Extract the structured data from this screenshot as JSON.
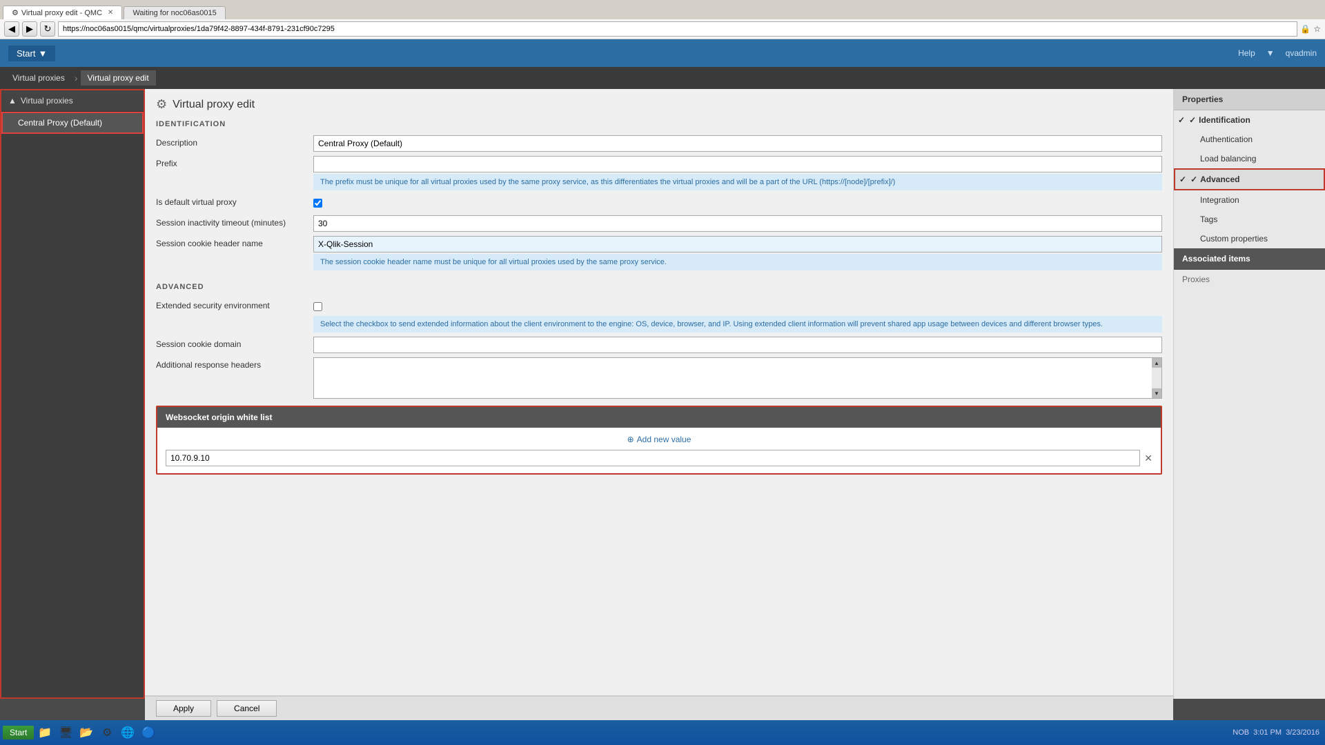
{
  "browser": {
    "address": "https://noc06as0015/qmc/virtualproxies/1da79f42-8897-434f-8791-231cf90c7295",
    "tabs": [
      {
        "label": "Virtual proxy edit - QMC",
        "active": true,
        "closeable": true
      },
      {
        "label": "Waiting for noc06as0015",
        "active": false,
        "closeable": false
      }
    ],
    "nav_back": "◀",
    "nav_forward": "▶",
    "refresh": "↻",
    "lock_icon": "🔒"
  },
  "app_header": {
    "start_label": "Start",
    "help_label": "Help",
    "user_label": "qvadmin"
  },
  "breadcrumb": {
    "items": [
      "Virtual proxies",
      "Virtual proxy edit"
    ]
  },
  "sidebar": {
    "section_label": "Virtual proxies",
    "items": [
      {
        "label": "Central Proxy (Default)",
        "active": true
      }
    ]
  },
  "page_title": "Virtual proxy edit",
  "form": {
    "identification_header": "IDENTIFICATION",
    "fields": {
      "description_label": "Description",
      "description_value": "Central Proxy (Default)",
      "prefix_label": "Prefix",
      "prefix_value": "",
      "prefix_hint": "The prefix must be unique for all virtual proxies used by the same proxy service, as this differentiates the virtual proxies and will be a part of the URL (https://[node]/[prefix]/)",
      "is_default_label": "Is default virtual proxy",
      "is_default_checked": true,
      "session_timeout_label": "Session inactivity timeout (minutes)",
      "session_timeout_value": "30",
      "session_cookie_label": "Session cookie header name",
      "session_cookie_value": "X-Qlik-Session",
      "session_cookie_hint": "The session cookie header name must be unique for all virtual proxies used by the same proxy service."
    },
    "advanced_header": "ADVANCED",
    "advanced_fields": {
      "extended_security_label": "Extended security environment",
      "extended_security_checked": false,
      "extended_security_hint": "Select the checkbox to send extended information about the client environment to the engine: OS, device, browser, and IP. Using extended client information will prevent shared app usage between devices and different browser types.",
      "session_cookie_domain_label": "Session cookie domain",
      "session_cookie_domain_value": "",
      "additional_headers_label": "Additional response headers",
      "additional_headers_value": ""
    }
  },
  "websocket": {
    "section_label": "Websocket origin white list",
    "add_btn": "Add new value",
    "entries": [
      {
        "value": "10.70.9.10"
      }
    ]
  },
  "footer": {
    "apply_label": "Apply",
    "cancel_label": "Cancel"
  },
  "properties_panel": {
    "title": "Properties",
    "items": [
      {
        "label": "Identification",
        "active": true,
        "checked": true
      },
      {
        "label": "Authentication",
        "active": false,
        "checked": false
      },
      {
        "label": "Load balancing",
        "active": false,
        "checked": false
      },
      {
        "label": "Advanced",
        "active": true,
        "checked": true,
        "highlighted": true
      },
      {
        "label": "Integration",
        "active": false,
        "checked": false
      },
      {
        "label": "Tags",
        "active": false,
        "checked": false
      },
      {
        "label": "Custom properties",
        "active": false,
        "checked": false
      }
    ],
    "associated_title": "Associated items",
    "associated_items": [
      {
        "label": "Proxies"
      }
    ]
  },
  "taskbar": {
    "time": "3:01 PM",
    "date": "3/23/2016",
    "start_label": "Start",
    "language": "NOB"
  },
  "icons": {
    "gear": "⚙",
    "checkmark": "✓",
    "plus_circle": "⊕",
    "close": "✕",
    "arrow_down": "▼",
    "arrow_up": "▲"
  }
}
